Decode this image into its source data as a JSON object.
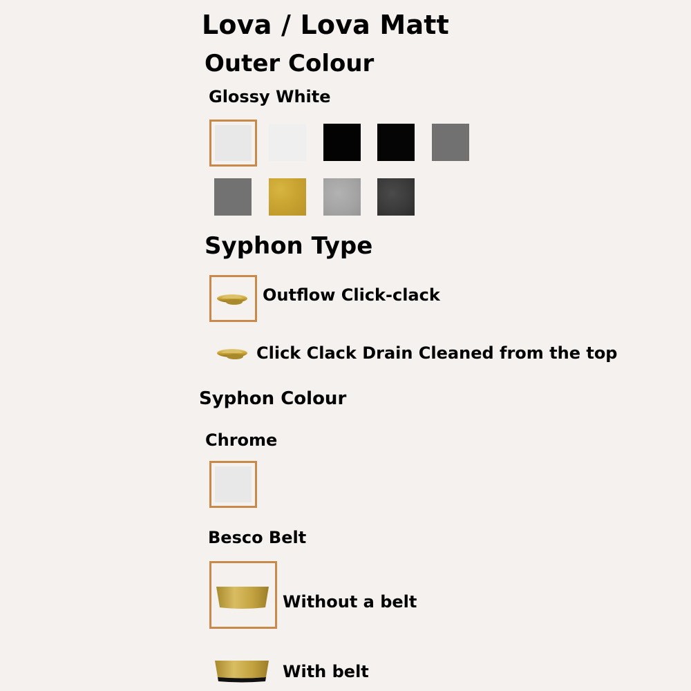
{
  "product": {
    "title": "Lova / Lova Matt"
  },
  "outer_colour": {
    "heading": "Outer Colour",
    "selected_label": "Glossy White",
    "swatches": [
      {
        "name": "glossy-white",
        "color": "#e9e8e8",
        "selected": true
      },
      {
        "name": "matt-white",
        "color": "#efefef",
        "selected": false
      },
      {
        "name": "glossy-black",
        "color": "#030303",
        "selected": false
      },
      {
        "name": "matt-black",
        "color": "#050505",
        "selected": false
      },
      {
        "name": "grey",
        "color": "#717171",
        "selected": false
      },
      {
        "name": "dark-grey",
        "color": "#727272",
        "selected": false
      },
      {
        "name": "gold",
        "color": "#c9a430",
        "selected": false
      },
      {
        "name": "silver-granite",
        "color": "#a6a6a6",
        "selected": false
      },
      {
        "name": "graphite",
        "color": "#3c3c3c",
        "selected": false
      }
    ]
  },
  "syphon_type": {
    "heading": "Syphon Type",
    "options": [
      {
        "label": "Outflow Click-clack",
        "selected": true
      },
      {
        "label": "Click Clack Drain Cleaned from the top",
        "selected": false
      }
    ]
  },
  "syphon_colour": {
    "heading": "Syphon Colour",
    "selected_label": "Chrome",
    "swatches": [
      {
        "name": "chrome",
        "color": "#e8e8e8",
        "selected": true
      }
    ]
  },
  "besco_belt": {
    "heading": "Besco Belt",
    "options": [
      {
        "label": "Without a belt",
        "selected": true
      },
      {
        "label": "With belt",
        "selected": false
      }
    ]
  },
  "colors": {
    "accent": "#c8894a",
    "background": "#f4f1ee",
    "gold": "#c9a430"
  }
}
